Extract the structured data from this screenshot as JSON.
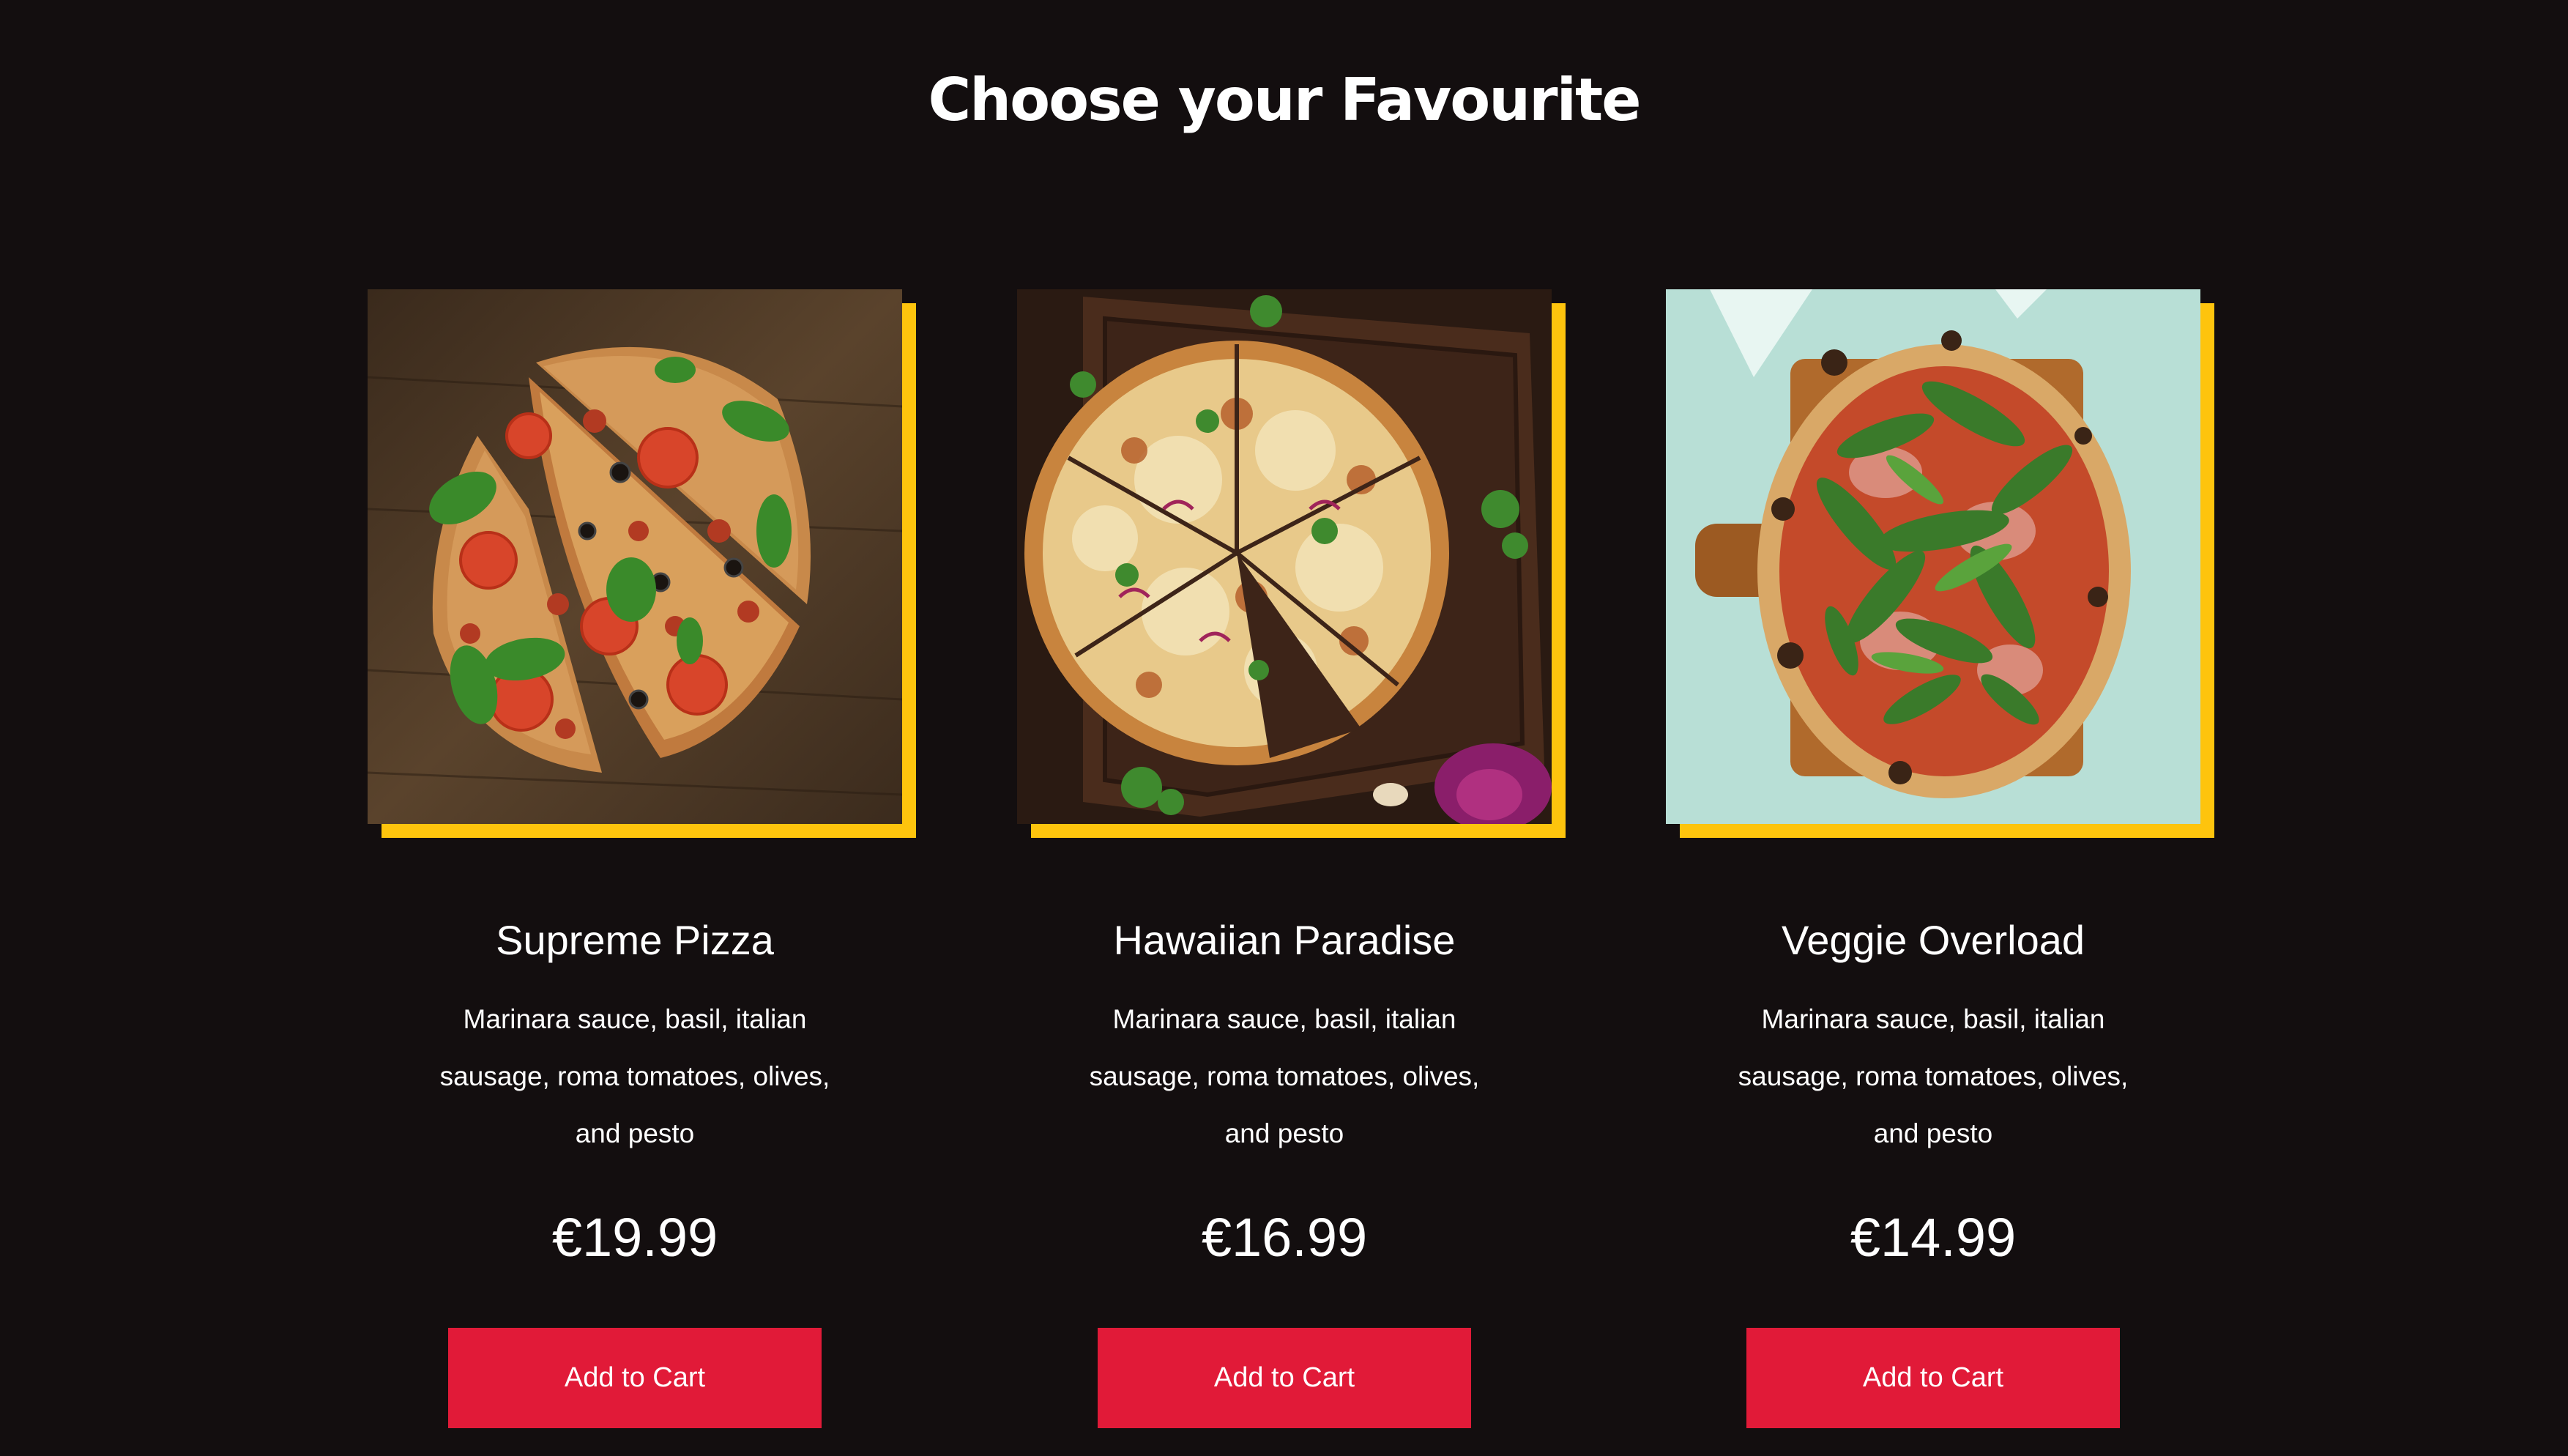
{
  "page": {
    "title": "Choose your Favourite"
  },
  "products": [
    {
      "name": "Supreme Pizza",
      "description": "Marinara sauce, basil, italian sausage, roma tomatoes, olives, and pesto",
      "price": "€19.99",
      "button_label": "Add to Cart"
    },
    {
      "name": "Hawaiian Paradise",
      "description": "Marinara sauce, basil, italian sausage, roma tomatoes, olives, and pesto",
      "price": "€16.99",
      "button_label": "Add to Cart"
    },
    {
      "name": "Veggie Overload",
      "description": "Marinara sauce, basil, italian sausage, roma tomatoes, olives, and pesto",
      "price": "€14.99",
      "button_label": "Add to Cart"
    }
  ],
  "colors": {
    "background": "#130e0f",
    "accent_frame": "#fec40d",
    "button": "#e11a38",
    "text": "#ffffff"
  }
}
